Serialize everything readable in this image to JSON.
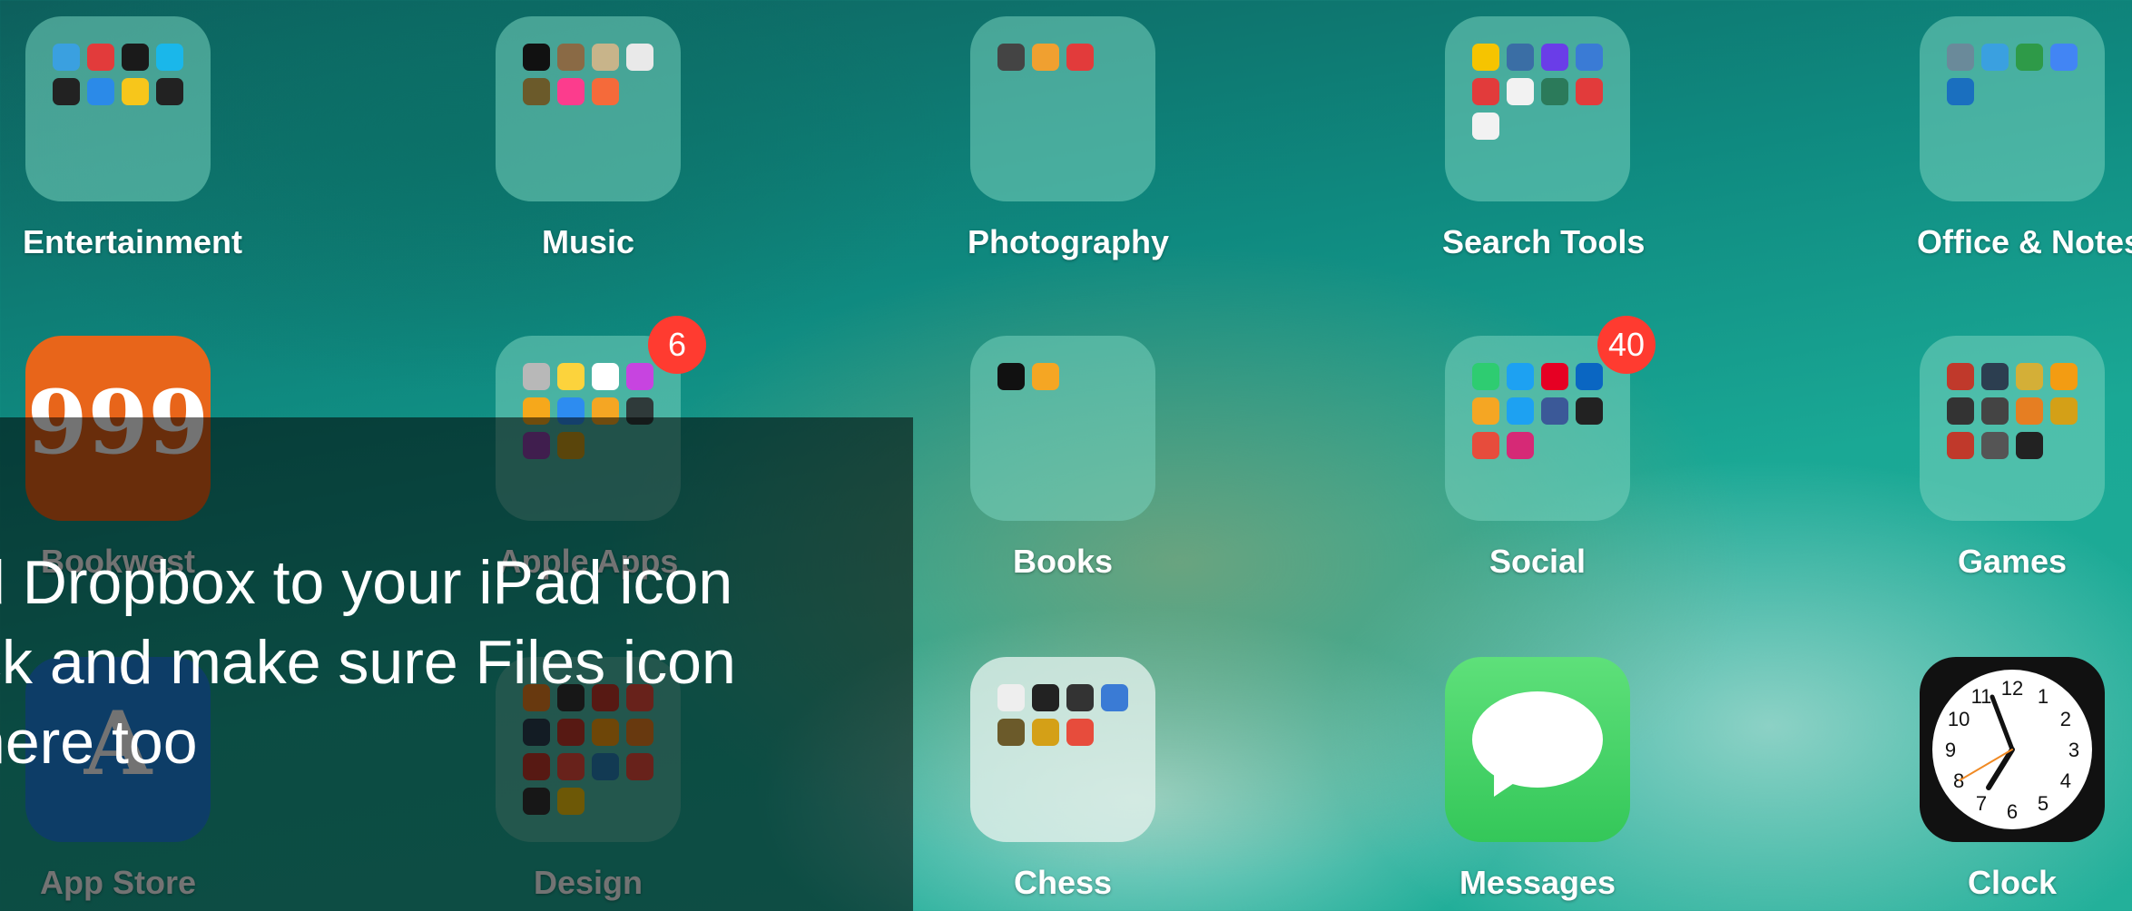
{
  "home": {
    "apps": [
      {
        "label": "Entertainment",
        "type": "folder",
        "minis": [
          "#3aa0e0",
          "#e23b3b",
          "#1a1a1a",
          "#1ab7ea",
          "#222222",
          "#2b8ae8",
          "#f7c61b",
          "#222222"
        ]
      },
      {
        "label": "Music",
        "type": "folder",
        "minis": [
          "#111111",
          "#8a6a45",
          "#c8b48a",
          "#e9e9e9",
          "#6b5a2a",
          "#fc3c8d",
          "#f56a3a"
        ]
      },
      {
        "label": "Photography",
        "type": "folder",
        "minis": [
          "#444444",
          "#f0a030",
          "#e23b3b"
        ]
      },
      {
        "label": "Search Tools",
        "type": "folder",
        "minis": [
          "#f6c400",
          "#3a6ea5",
          "#6a3de8",
          "#3a7bd5",
          "#e23b3b",
          "#f2f2f2",
          "#2b7a5a",
          "#e23b3b",
          "#f2f2f2"
        ]
      },
      {
        "label": "Office & Notes",
        "type": "folder",
        "minis": [
          "#6a8a9a",
          "#3aa0e0",
          "#2e9a48",
          "#4285f4",
          "#1a6fbf"
        ]
      },
      {
        "label": "Bookwest",
        "type": "app",
        "color": "#e8651a",
        "glyph": "999"
      },
      {
        "label": "Apple Apps",
        "type": "folder",
        "badge": "6",
        "minis": [
          "#b8b8b8",
          "#fcd33c",
          "#ffffff",
          "#c744e0",
          "#f6a81b",
          "#2d8cf0",
          "#f5a623",
          "#2f3a3a",
          "#8e44ad",
          "#c79a1a"
        ]
      },
      {
        "label": "Books",
        "type": "folder",
        "minis": [
          "#111111",
          "#f5a623"
        ]
      },
      {
        "label": "Social",
        "type": "folder",
        "badge": "40",
        "minis": [
          "#2ecc71",
          "#1da1f2",
          "#e60023",
          "#0a66c2",
          "#f5a623",
          "#1da1f2",
          "#3b5998",
          "#222222",
          "#e74c3c",
          "#d62976"
        ]
      },
      {
        "label": "Games",
        "type": "folder",
        "minis": [
          "#c0392b",
          "#2c3e50",
          "#d4af37",
          "#f39c12",
          "#333333",
          "#444444",
          "#e67e22",
          "#d4a017",
          "#c0392b",
          "#555555",
          "#222222"
        ]
      },
      {
        "label": "App Store",
        "type": "app",
        "color": "#1e88e5",
        "glyph": "A"
      },
      {
        "label": "Design",
        "type": "folder",
        "minis": [
          "#e67e22",
          "#333333",
          "#c0392b",
          "#e74c3c",
          "#2c3e50",
          "#c0392b",
          "#f39c12",
          "#e67e22",
          "#c0392b",
          "#e74c3c",
          "#2980b9",
          "#e74c3c",
          "#333333",
          "#f1c40f"
        ]
      },
      {
        "label": "Chess",
        "type": "folder",
        "light": true,
        "minis": [
          "#eeeeee",
          "#222222",
          "#333333",
          "#3a7bd5",
          "#6b5a2a",
          "#d4a017",
          "#e74c3c"
        ]
      },
      {
        "label": "Messages",
        "type": "messages",
        "color": "#34c759"
      },
      {
        "label": "Clock",
        "type": "clock",
        "color": "#111111"
      }
    ]
  },
  "overlay": {
    "text": "d Dropbox to your iPad icon\nck and make sure Files icon\nhere too"
  }
}
